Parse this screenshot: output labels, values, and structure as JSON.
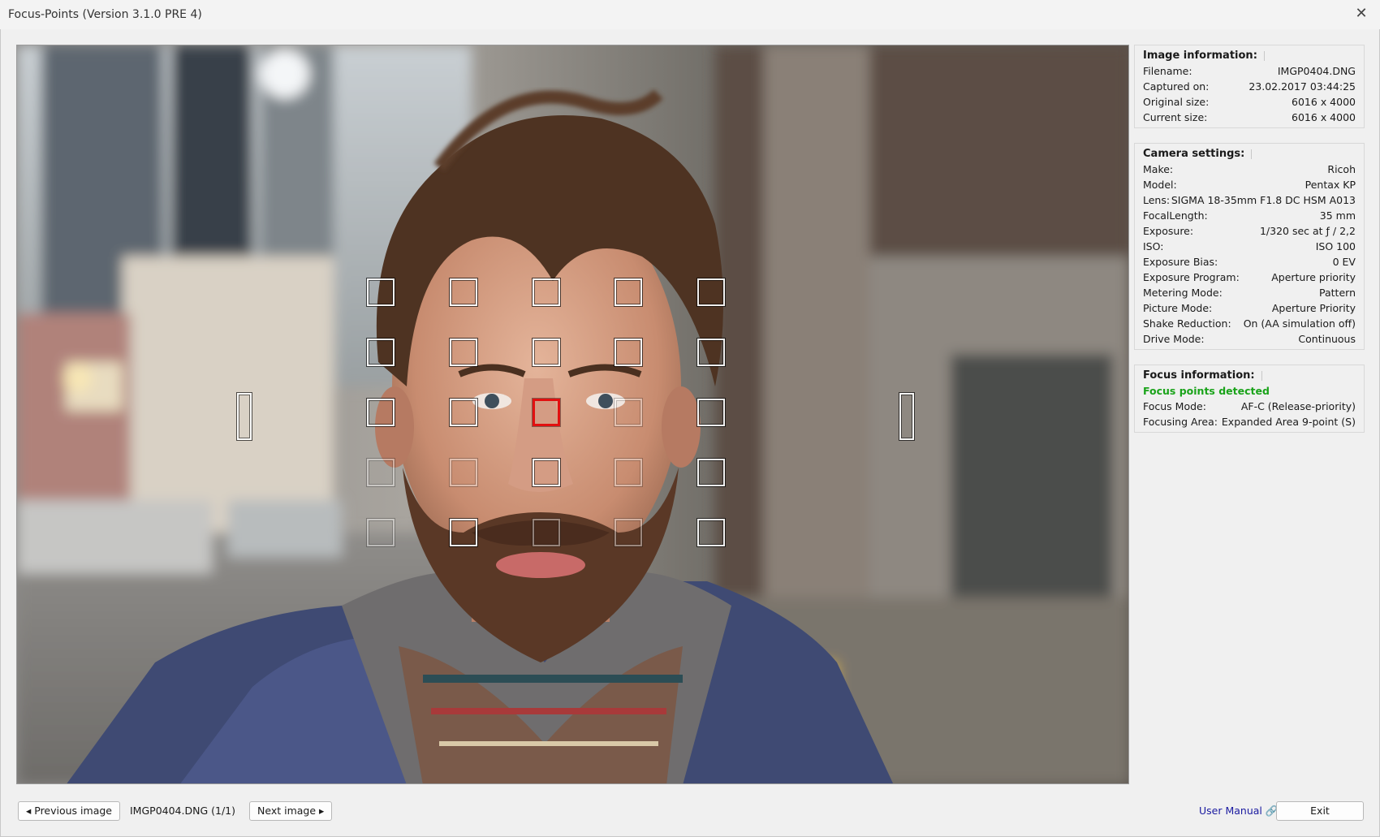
{
  "window": {
    "title": "Focus-Points (Version 3.1.0 PRE 4)",
    "close_glyph": "✕"
  },
  "image_info": {
    "title": "Image information:",
    "rows": [
      {
        "label": "Filename:",
        "value": "IMGP0404.DNG"
      },
      {
        "label": "Captured on:",
        "value": "23.02.2017 03:44:25"
      },
      {
        "label": "Original size:",
        "value": "6016 x 4000"
      },
      {
        "label": "Current size:",
        "value": "6016 x 4000"
      }
    ]
  },
  "camera_settings": {
    "title": "Camera settings:",
    "rows": [
      {
        "label": "Make:",
        "value": "Ricoh"
      },
      {
        "label": "Model:",
        "value": "Pentax KP"
      },
      {
        "label": "Lens:",
        "value": "SIGMA 18-35mm F1.8 DC HSM A013"
      },
      {
        "label": "FocalLength:",
        "value": "35 mm"
      },
      {
        "label": "Exposure:",
        "value": "1/320 sec at ƒ / 2,2"
      },
      {
        "label": "ISO:",
        "value": "ISO 100"
      },
      {
        "label": "Exposure Bias:",
        "value": "0 EV"
      },
      {
        "label": "Exposure Program:",
        "value": "Aperture priority"
      },
      {
        "label": "Metering Mode:",
        "value": "Pattern"
      },
      {
        "label": "Picture Mode:",
        "value": "Aperture Priority"
      },
      {
        "label": "Shake Reduction:",
        "value": "On (AA simulation off)"
      },
      {
        "label": "Drive Mode:",
        "value": "Continuous"
      }
    ]
  },
  "focus_info": {
    "title": "Focus information:",
    "status": "Focus points detected",
    "status_color": "#1aa31a",
    "rows": [
      {
        "label": "Focus Mode:",
        "value": "AF-C (Release-priority)"
      },
      {
        "label": "Focusing Area:",
        "value": "Expanded Area 9-point (S)"
      }
    ]
  },
  "focus_points": {
    "grid_columns": 5,
    "grid_rows": 5,
    "active_point": {
      "row": 2,
      "col": 2
    },
    "active_color": "#e11010"
  },
  "bottom": {
    "prev_label": "◂ Previous image",
    "file_label": "IMGP0404.DNG (1/1)",
    "next_label": "Next image ▸",
    "manual_label": "User Manual 🔗",
    "exit_label": "Exit"
  }
}
